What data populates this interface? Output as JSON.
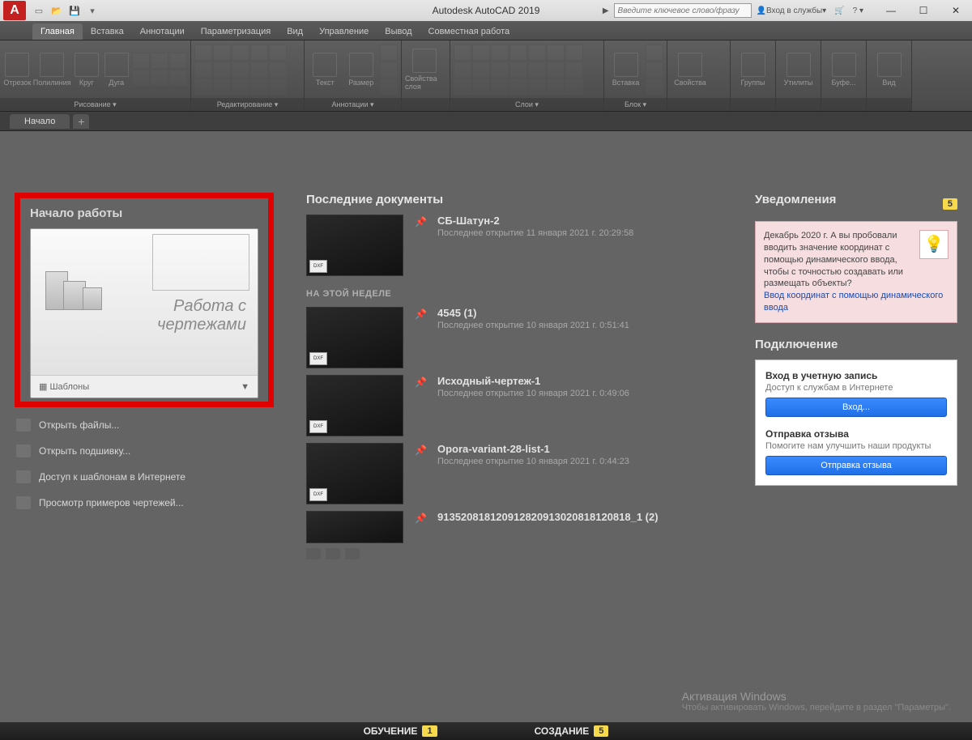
{
  "title": "Autodesk AutoCAD 2019",
  "search_placeholder": "Введите ключевое слово/фразу",
  "login_label": "Вход в службы",
  "ribbon_tabs": [
    "Главная",
    "Вставка",
    "Аннотации",
    "Параметризация",
    "Вид",
    "Управление",
    "Вывод",
    "Совместная работа"
  ],
  "ribbon_panels": {
    "draw": {
      "title": "Рисование ▾",
      "big": [
        "Отрезок",
        "Полилиния",
        "Круг",
        "Дуга"
      ]
    },
    "edit": {
      "title": "Редактирование ▾"
    },
    "annot": {
      "title": "Аннотации ▾",
      "big": [
        "Текст",
        "Размер"
      ]
    },
    "lprops": {
      "title": "",
      "big": [
        "Свойства слоя"
      ]
    },
    "layers": {
      "title": "Слои ▾"
    },
    "block": {
      "title": "Блок ▾",
      "big": [
        "Вставка"
      ]
    },
    "props": {
      "title": "",
      "big": [
        "Свойства"
      ]
    },
    "groups": {
      "title": "",
      "big": [
        "Группы"
      ]
    },
    "utils": {
      "title": "",
      "big": [
        "Утилиты"
      ]
    },
    "clip": {
      "title": "",
      "big": [
        "Буфе..."
      ]
    },
    "view": {
      "title": "",
      "big": [
        "Вид"
      ]
    }
  },
  "doc_tab": "Начало",
  "left": {
    "heading": "Начало работы",
    "card_text_1": "Работа с",
    "card_text_2": "чертежами",
    "templates": "Шаблоны",
    "links": [
      "Открыть файлы...",
      "Открыть подшивку...",
      "Доступ к шаблонам в Интернете",
      "Просмотр примеров чертежей..."
    ]
  },
  "mid": {
    "heading": "Последние документы",
    "week_sep": "НА ЭТОЙ НЕДЕЛЕ",
    "items": [
      {
        "name": "СБ-Шатун-2",
        "sub": "Последнее открытие 11 января 2021 г. 20:29:58"
      },
      {
        "name": "4545 (1)",
        "sub": "Последнее открытие 10 января 2021 г. 0:51:41"
      },
      {
        "name": "Исходный-чертеж-1",
        "sub": "Последнее открытие 10 января 2021 г. 0:49:06"
      },
      {
        "name": "Opora-variant-28-list-1",
        "sub": "Последнее открытие 10 января 2021 г. 0:44:23"
      },
      {
        "name": "913520818120912820913020818120818_1 (2)",
        "sub": ""
      }
    ]
  },
  "right": {
    "notif_title": "Уведомления",
    "notif_badge": "5",
    "notif_body": "Декабрь 2020 г. А вы пробовали вводить значение координат с помощью динамического ввода, чтобы с точностью создавать или размещать объекты?",
    "notif_link": "Ввод координат с помощью динамического ввода",
    "connect_title": "Подключение",
    "signin_h": "Вход в учетную запись",
    "signin_p": "Доступ к службам в Интернете",
    "signin_btn": "Вход...",
    "feedback_h": "Отправка отзыва",
    "feedback_p": "Помогите нам улучшить наши продукты",
    "feedback_btn": "Отправка отзыва"
  },
  "winact_title": "Активация Windows",
  "winact_sub": "Чтобы активировать Windows, перейдите в раздел \"Параметры\".",
  "bottom": {
    "learn": "ОБУЧЕНИЕ",
    "learn_badge": "1",
    "create": "СОЗДАНИЕ",
    "create_badge": "5"
  }
}
